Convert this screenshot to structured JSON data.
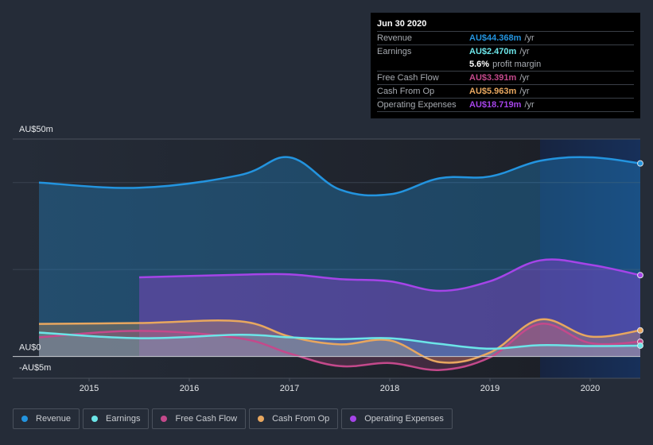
{
  "tooltip": {
    "date": "Jun 30 2020",
    "rows": [
      {
        "label": "Revenue",
        "value": "AU$44.368m",
        "unit": "/yr",
        "color": "#2394df"
      },
      {
        "label": "Earnings",
        "value": "AU$2.470m",
        "unit": "/yr",
        "color": "#6ce5e8"
      },
      {
        "label": "",
        "value": "5.6%",
        "unit": "profit margin",
        "color": "#ffffff"
      },
      {
        "label": "Free Cash Flow",
        "value": "AU$3.391m",
        "unit": "/yr",
        "color": "#c4498b"
      },
      {
        "label": "Cash From Op",
        "value": "AU$5.963m",
        "unit": "/yr",
        "color": "#e8a75f"
      },
      {
        "label": "Operating Expenses",
        "value": "AU$18.719m",
        "unit": "/yr",
        "color": "#a544e8"
      }
    ]
  },
  "legend": [
    {
      "label": "Revenue",
      "color": "#2394df"
    },
    {
      "label": "Earnings",
      "color": "#6ce5e8"
    },
    {
      "label": "Free Cash Flow",
      "color": "#c4498b"
    },
    {
      "label": "Cash From Op",
      "color": "#e8a75f"
    },
    {
      "label": "Operating Expenses",
      "color": "#a544e8"
    }
  ],
  "chart_data": {
    "type": "area",
    "title": "",
    "xlabel": "",
    "ylabel": "",
    "currency": "AU$",
    "xlim": [
      2014.25,
      2020.5
    ],
    "ylim": [
      -5,
      50
    ],
    "y_tick_labels": [
      {
        "value": 50,
        "label": "AU$50m"
      },
      {
        "value": 0,
        "label": "AU$0"
      },
      {
        "value": -5,
        "label": "-AU$5m"
      }
    ],
    "y_gridlines": [
      20,
      40
    ],
    "x_ticks": [
      {
        "value": 2015,
        "label": "2015"
      },
      {
        "value": 2016,
        "label": "2016"
      },
      {
        "value": 2017,
        "label": "2017"
      },
      {
        "value": 2018,
        "label": "2018"
      },
      {
        "value": 2019,
        "label": "2019"
      },
      {
        "value": 2020,
        "label": "2020"
      }
    ],
    "highlight_from": 2019.5,
    "grid": true,
    "legend_position": "bottom-left",
    "series": [
      {
        "name": "Revenue",
        "color": "#2394df",
        "x": [
          2014.5,
          2015.5,
          2016.5,
          2017.0,
          2017.5,
          2018.0,
          2018.5,
          2019.0,
          2019.5,
          2020.0,
          2020.5
        ],
        "values": [
          40.0,
          38.8,
          41.7,
          45.8,
          38.4,
          37.3,
          41.0,
          41.4,
          45.0,
          45.8,
          44.4
        ]
      },
      {
        "name": "Operating Expenses",
        "color": "#a544e8",
        "x": [
          2015.5,
          2016.5,
          2017.0,
          2017.5,
          2018.0,
          2018.5,
          2019.0,
          2019.5,
          2020.0,
          2020.5
        ],
        "values": [
          18.2,
          18.8,
          18.9,
          17.8,
          17.3,
          15.1,
          17.3,
          22.1,
          21.1,
          18.7
        ]
      },
      {
        "name": "Cash From Op",
        "color": "#e8a75f",
        "x": [
          2014.5,
          2015.5,
          2016.5,
          2017.0,
          2017.5,
          2018.0,
          2018.5,
          2019.0,
          2019.5,
          2020.0,
          2020.5
        ],
        "values": [
          7.5,
          7.7,
          8.1,
          4.6,
          2.8,
          3.7,
          -1.3,
          0.9,
          8.5,
          4.6,
          6.0
        ]
      },
      {
        "name": "Free Cash Flow",
        "color": "#c4498b",
        "x": [
          2014.5,
          2015.5,
          2016.5,
          2017.0,
          2017.5,
          2018.0,
          2018.5,
          2019.0,
          2019.5,
          2020.0,
          2020.5
        ],
        "values": [
          4.4,
          5.9,
          4.2,
          0.7,
          -2.2,
          -1.5,
          -3.1,
          -0.2,
          7.5,
          3.1,
          3.4
        ]
      },
      {
        "name": "Earnings",
        "color": "#6ce5e8",
        "x": [
          2014.5,
          2015.5,
          2016.5,
          2017.0,
          2017.5,
          2018.0,
          2018.5,
          2019.0,
          2019.5,
          2020.0,
          2020.5
        ],
        "values": [
          5.5,
          4.2,
          5.0,
          4.4,
          4.0,
          4.2,
          2.9,
          1.8,
          2.6,
          2.4,
          2.5
        ]
      }
    ]
  }
}
